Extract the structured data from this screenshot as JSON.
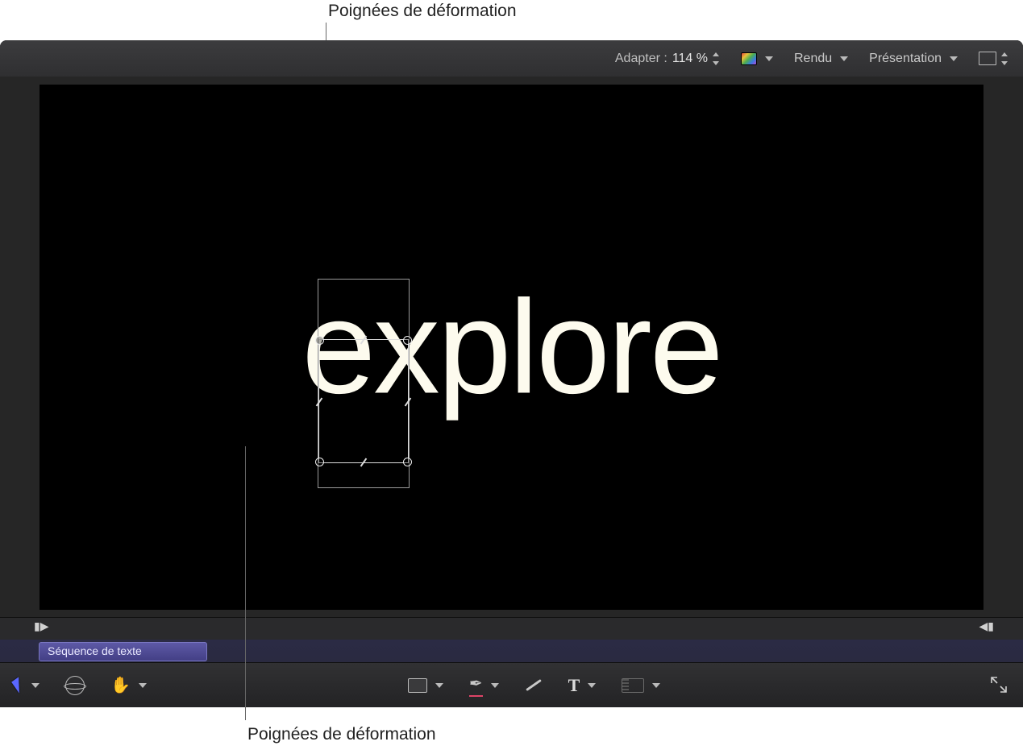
{
  "callouts": {
    "top": "Poignées de déformation",
    "bottom": "Poignées de déformation"
  },
  "toolbar": {
    "adapter_label": "Adapter :",
    "adapter_value": "114 %",
    "rendu_label": "Rendu",
    "presentation_label": "Présentation"
  },
  "canvas": {
    "text": "explore"
  },
  "mini_timeline": {
    "chip_label": "Séquence de texte"
  },
  "ruler": {
    "in_marker_glyph": "▶",
    "out_marker_glyph": "◀"
  },
  "bottom_tools": {
    "text_tool_glyph": "T",
    "hand_glyph": "✋",
    "pen_glyph": "✒"
  }
}
